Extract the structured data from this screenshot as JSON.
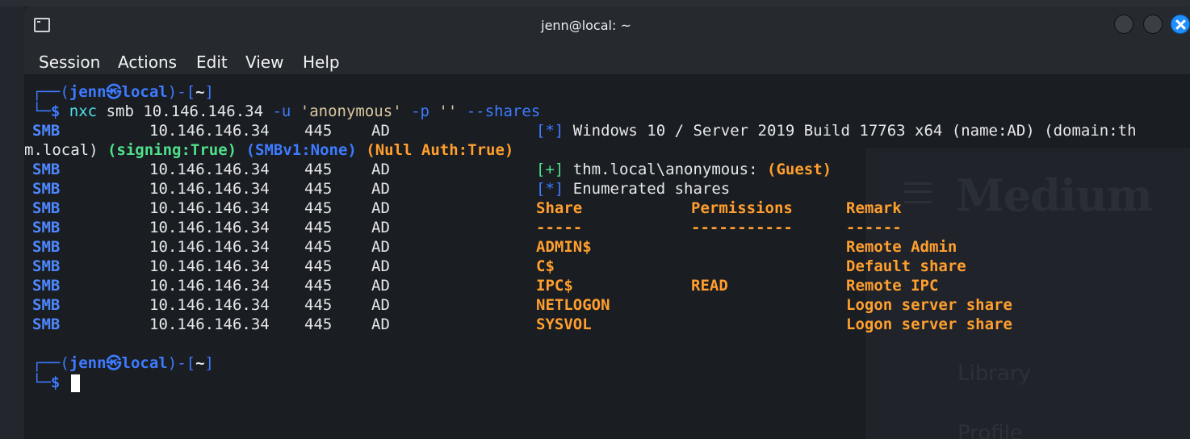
{
  "window": {
    "title": "jenn@local: ~"
  },
  "menu": [
    "Session",
    "Actions",
    "Edit",
    "View",
    "Help"
  ],
  "prompt": {
    "top": "┌──(",
    "user": "jenn",
    "at": "㉿",
    "host": "local",
    "mid": ")-[",
    "dir": "~",
    "end": "]",
    "bottom": "└─",
    "sign": "$"
  },
  "command": {
    "bin": "nxc",
    "args1": " smb 10.146.146.34 ",
    "flag_u": "-u",
    "user_val": " 'anonymous' ",
    "flag_p": "-p",
    "pass_val": " '' ",
    "flag_shares": "--shares"
  },
  "smb_info": {
    "host": "10.146.146.34",
    "port": "445",
    "name": "AD",
    "info_tag": "[*]",
    "info_text": " Windows 10 / Server 2019 Build 17763 x64 (name:AD) (domain:th",
    "wrap_text": "m.local) ",
    "signing": "(signing:True)",
    "smbv1": "(SMBv1:None)",
    "null_auth": "(Null Auth:True)"
  },
  "auth": {
    "tag": "[+]",
    "text": " thm.local\\anonymous: ",
    "result": "(Guest)"
  },
  "enum": {
    "tag": "[*]",
    "text": " Enumerated shares"
  },
  "proto": "SMB",
  "shares_header": {
    "share": "Share",
    "permissions": "Permissions",
    "remark": "Remark",
    "share_rule": "-----",
    "perm_rule": "-----------",
    "remark_rule": "------"
  },
  "shares": [
    {
      "name": "ADMIN$",
      "perm": "",
      "remark": "Remote Admin"
    },
    {
      "name": "C$",
      "perm": "",
      "remark": "Default share"
    },
    {
      "name": "IPC$",
      "perm": "READ",
      "remark": "Remote IPC"
    },
    {
      "name": "NETLOGON",
      "perm": "",
      "remark": "Logon server share"
    },
    {
      "name": "SYSVOL",
      "perm": "",
      "remark": "Logon server share"
    }
  ],
  "ghost": {
    "brand": "Medium",
    "library": "Library",
    "profile": "Profile"
  }
}
